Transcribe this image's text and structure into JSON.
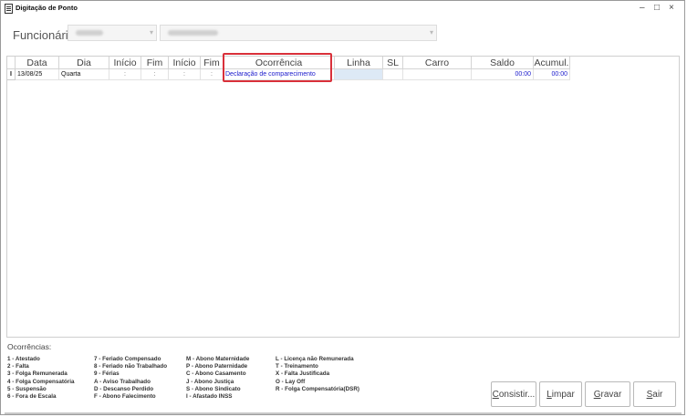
{
  "window": {
    "title": "Digitação de Ponto",
    "minimize": "–",
    "maximize": "□",
    "close": "×"
  },
  "employee": {
    "label": "Funcionário:",
    "id_value": "",
    "name_value": ""
  },
  "table": {
    "columns": [
      "Data",
      "Dia",
      "Início",
      "Fim",
      "Início",
      "Fim",
      "Ocorrência",
      "Linha",
      "SL",
      "Carro",
      "Saldo",
      "Acumul."
    ],
    "row_indicator": "I",
    "rows": [
      {
        "data": "13/08/25",
        "dia": "Quarta",
        "inicio1": ":",
        "fim1": ":",
        "inicio2": ":",
        "fim2": ":",
        "ocorrencia": "Declaração de comparecimento",
        "linha": "",
        "sl": "",
        "carro": "",
        "saldo": "00:00",
        "acumul": "00:00"
      }
    ]
  },
  "legend": {
    "title": "Ocorrências:",
    "col1": [
      "1 - Atestado",
      "2 - Falta",
      "3 - Folga Remunerada",
      "4 - Folga Compensatória",
      "5 - Suspensão",
      "6 - Fora de Escala"
    ],
    "col2": [
      "7 - Feriado Compensado",
      "8 - Feriado não Trabalhado",
      "9 - Férias",
      "A - Aviso Trabalhado",
      "D - Descanso Perdido",
      "F - Abono Falecimento"
    ],
    "col3": [
      "M - Abono Maternidade",
      "P - Abono Paternidade",
      "C - Abono Casamento",
      "J - Abono Justiça",
      "S - Abono Sindicato",
      "I - Afastado INSS"
    ],
    "col4": [
      "L - Licença não Remunerada",
      "T - Treinamento",
      "X - Falta Justificada",
      "O - Lay Off",
      "R - Folga Compensatória(DSR)"
    ]
  },
  "buttons": {
    "consistir": {
      "mnemonic": "C",
      "rest": "onsistir..."
    },
    "limpar": {
      "mnemonic": "L",
      "rest": "impar"
    },
    "gravar": {
      "mnemonic": "G",
      "rest": "ravar"
    },
    "sair": {
      "mnemonic": "S",
      "rest": "air"
    }
  }
}
